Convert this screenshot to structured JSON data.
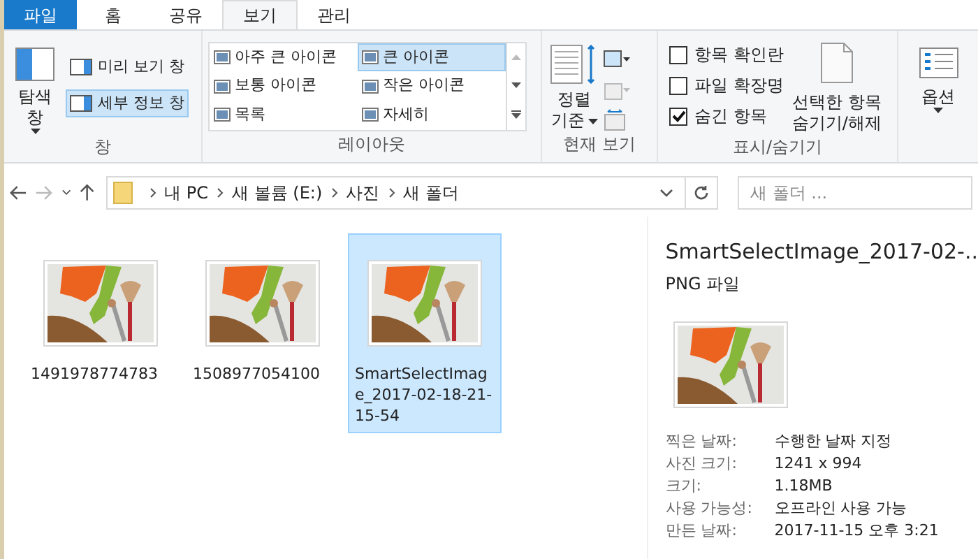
{
  "tabs": [
    {
      "label": "파일",
      "kind": "file",
      "selected": false
    },
    {
      "label": "홈",
      "kind": "tab",
      "selected": false
    },
    {
      "label": "공유",
      "kind": "tab",
      "selected": false
    },
    {
      "label": "보기",
      "kind": "tab",
      "selected": true
    },
    {
      "label": "관리",
      "kind": "tab",
      "selected": false
    }
  ],
  "ribbon": {
    "panes": {
      "label": "창",
      "navigation_pane": "탐색 창",
      "items": [
        {
          "label": "미리 보기 창",
          "selected": false
        },
        {
          "label": "세부 정보 창",
          "selected": true
        }
      ]
    },
    "layout": {
      "label": "레이아웃",
      "options": [
        {
          "label": "아주 큰 아이콘",
          "selected": false
        },
        {
          "label": "큰 아이콘",
          "selected": true
        },
        {
          "label": "보통 아이콘",
          "selected": false
        },
        {
          "label": "작은 아이콘",
          "selected": false
        },
        {
          "label": "목록",
          "selected": false
        },
        {
          "label": "자세히",
          "selected": false
        }
      ]
    },
    "current_view": {
      "label": "현재 보기",
      "sort_line_1": "정렬",
      "sort_line_2": "기준"
    },
    "show_hide": {
      "label": "표시/숨기기",
      "checkboxes": [
        {
          "label": "항목 확인란",
          "checked": false
        },
        {
          "label": "파일 확장명",
          "checked": false
        },
        {
          "label": "숨긴 항목",
          "checked": true
        }
      ],
      "hide_line_1": "선택한 항목",
      "hide_line_2": "숨기기/해제"
    },
    "options": {
      "label": "옵션"
    }
  },
  "address": {
    "path": [
      "내 PC",
      "새 볼륨 (E:)",
      "사진",
      "새 폴더"
    ],
    "search_placeholder": "새 폴더 ..."
  },
  "files": [
    {
      "name": "1491978774783",
      "selected": false
    },
    {
      "name": "1508977054100",
      "selected": false
    },
    {
      "name": "SmartSelectImage_2017-02-18-21-15-54",
      "selected": true
    }
  ],
  "details": {
    "title": "SmartSelectImage_2017-02-..",
    "type": "PNG 파일",
    "properties": [
      {
        "label": "찍은 날짜:",
        "value": "수행한 날짜 지정"
      },
      {
        "label": "사진 크기:",
        "value": "1241 x 994"
      },
      {
        "label": "크기:",
        "value": "1.18MB"
      },
      {
        "label": "사용 가능성:",
        "value": "오프라인 사용 가능"
      },
      {
        "label": "만든 날짜:",
        "value": "2017-11-15 오후 3:21"
      }
    ]
  }
}
